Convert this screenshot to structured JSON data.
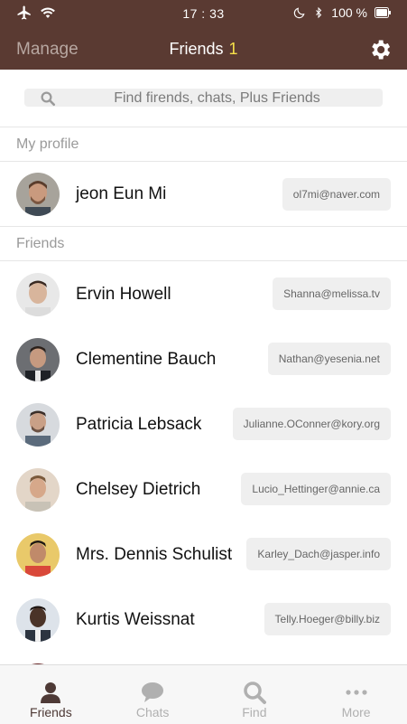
{
  "status_bar": {
    "time": "17 : 33",
    "battery": "100 %"
  },
  "header": {
    "manage_label": "Manage",
    "title": "Friends",
    "count": "1"
  },
  "search": {
    "placeholder": "Find firends, chats, Plus Friends"
  },
  "my_profile": {
    "section_label": "My profile",
    "name": "jeon Eun Mi",
    "email": "ol7mi@naver.com"
  },
  "friends": {
    "section_label": "Friends",
    "items": [
      {
        "name": "Ervin Howell",
        "email": "Shanna@melissa.tv"
      },
      {
        "name": "Clementine Bauch",
        "email": "Nathan@yesenia.net"
      },
      {
        "name": "Patricia Lebsack",
        "email": "Julianne.OConner@kory.org"
      },
      {
        "name": "Chelsey Dietrich",
        "email": "Lucio_Hettinger@annie.ca"
      },
      {
        "name": "Mrs. Dennis Schulist",
        "email": "Karley_Dach@jasper.info"
      },
      {
        "name": "Kurtis Weissnat",
        "email": "Telly.Hoeger@billy.biz"
      }
    ]
  },
  "tabs": [
    {
      "label": "Friends",
      "icon": "person-icon",
      "active": true
    },
    {
      "label": "Chats",
      "icon": "chat-bubble-icon",
      "active": false
    },
    {
      "label": "Find",
      "icon": "search-icon",
      "active": false
    },
    {
      "label": "More",
      "icon": "more-dots-icon",
      "active": false
    }
  ],
  "colors": {
    "header_bg": "#5a3a32",
    "count_accent": "#f6e04a",
    "active_tab": "#4e3a36",
    "inactive_tab": "#b0b0b0"
  }
}
